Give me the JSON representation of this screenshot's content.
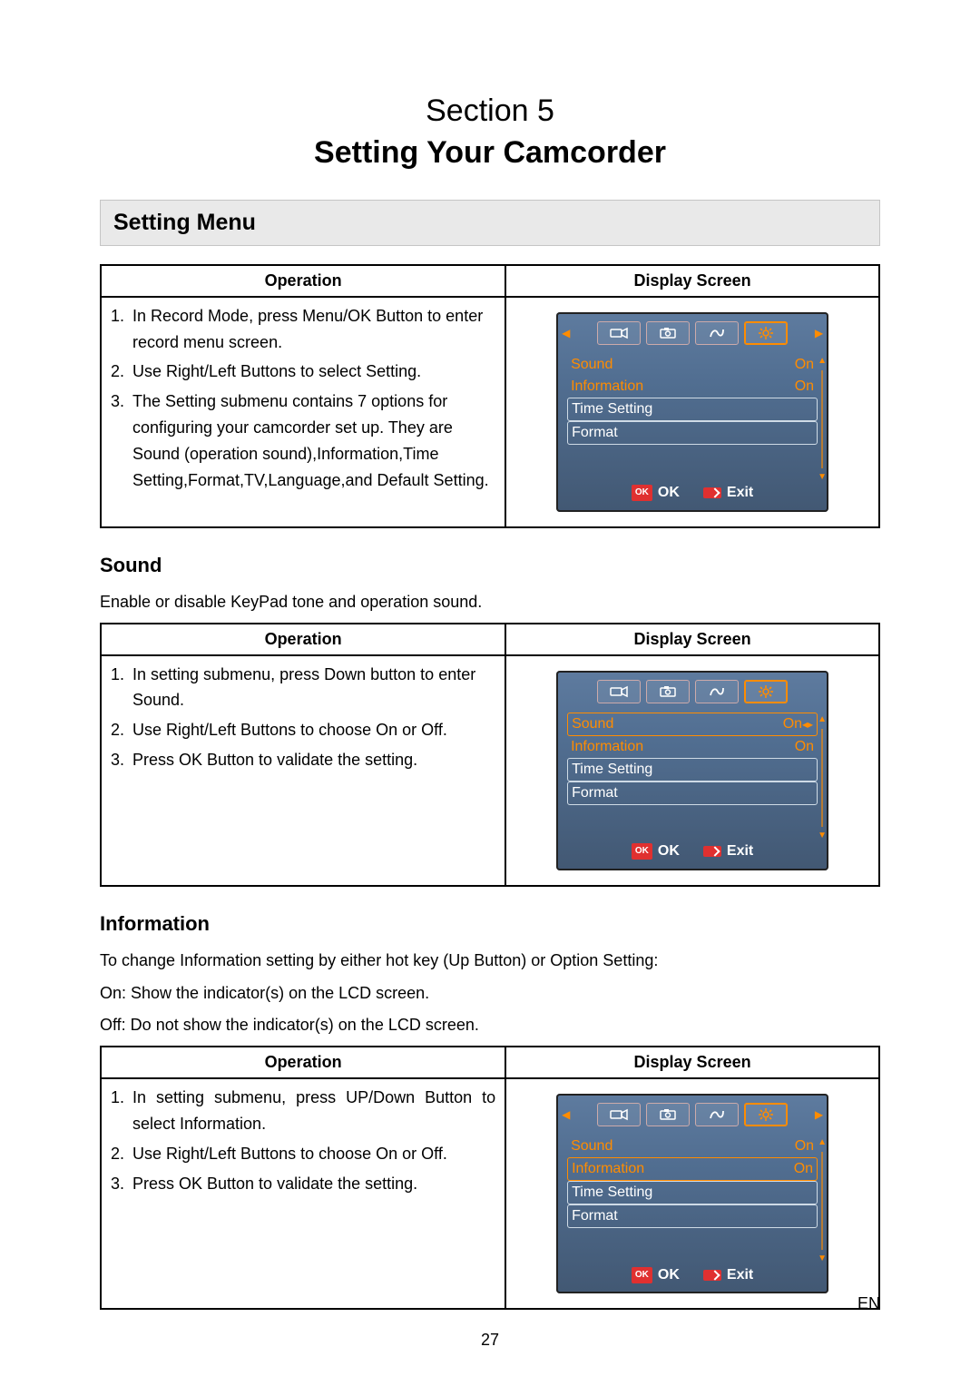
{
  "header": {
    "section_label": "Section 5",
    "title": "Setting Your Camcorder"
  },
  "h2": {
    "setting_menu": "Setting Menu"
  },
  "table_headers": {
    "operation": "Operation",
    "display": "Display Screen"
  },
  "setting_menu_ops": [
    {
      "n": "1.",
      "t": "In Record Mode, press Menu/OK Button to enter record menu screen."
    },
    {
      "n": "2.",
      "t": "Use Right/Left Buttons to select Setting."
    },
    {
      "n": "3.",
      "t": "The Setting submenu contains 7 options for configuring your camcorder set up. They are Sound (operation sound),Information,Time Setting,Format,TV,Language,and Default Setting."
    }
  ],
  "sound": {
    "heading": "Sound",
    "intro": "Enable or disable KeyPad tone and operation sound.",
    "ops": [
      {
        "n": "1.",
        "t": "In setting submenu, press Down button to enter Sound."
      },
      {
        "n": "2.",
        "t": "Use Right/Left Buttons to choose On or Off."
      },
      {
        "n": "3.",
        "t": "Press OK Button to validate the setting."
      }
    ]
  },
  "information": {
    "heading": "Information",
    "intro1": "To change Information setting by either hot key (Up Button) or Option Setting:",
    "intro2": "On: Show the indicator(s) on the LCD screen.",
    "intro3": "Off: Do not show the indicator(s) on the LCD screen.",
    "ops": [
      {
        "n": "1.",
        "t": "In setting submenu, press UP/Down Button to select Information."
      },
      {
        "n": "2.",
        "t": "Use Right/Left Buttons to choose On or Off."
      },
      {
        "n": "3.",
        "t": "Press OK Button to validate the setting."
      }
    ]
  },
  "lcd_common": {
    "items": {
      "sound": "Sound",
      "info": "Information",
      "time": "Time Setting",
      "format": "Format"
    },
    "on": "On",
    "on_arrows": "On",
    "ok": "OK",
    "ok_badge": "OK",
    "exit": "Exit"
  },
  "footer": {
    "page": "27",
    "lang": "EN"
  }
}
